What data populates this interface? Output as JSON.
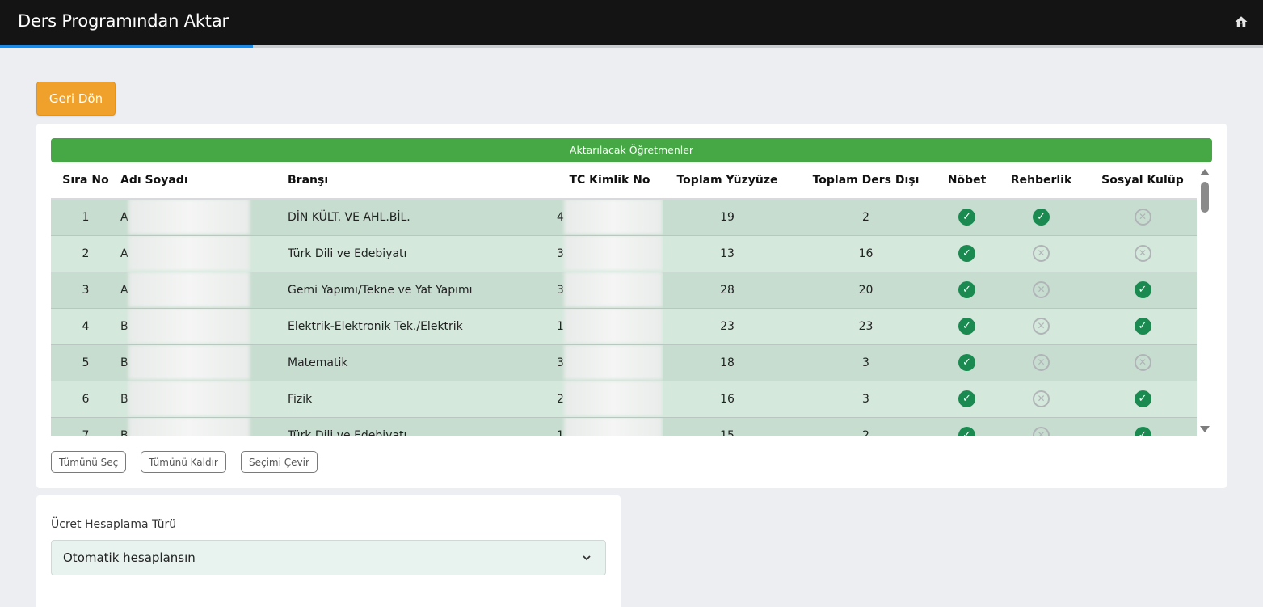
{
  "header": {
    "title": "Ders Programından Aktar",
    "home_icon": "home-icon",
    "progress": 0.2
  },
  "back_button": "Geri Dön",
  "teachers_panel": {
    "banner": "Aktarılacak Öğretmenler",
    "columns": [
      "Sıra No",
      "Adı Soyadı",
      "Branşı",
      "TC Kimlik No",
      "Toplam Yüzyüze",
      "Toplam Ders Dışı",
      "Nöbet",
      "Rehberlik",
      "Sosyal Kulüp"
    ],
    "rows": [
      {
        "no": "1",
        "name": "A",
        "branch": "DİN KÜLT. VE AHL.BİL.",
        "tc": "4",
        "yuzyuze": "19",
        "ders_disi": "2",
        "nobet": true,
        "rehberlik": true,
        "sosyal": false
      },
      {
        "no": "2",
        "name": "A",
        "branch": "Türk Dili ve Edebiyatı",
        "tc": "3",
        "yuzyuze": "13",
        "ders_disi": "16",
        "nobet": true,
        "rehberlik": false,
        "sosyal": false
      },
      {
        "no": "3",
        "name": "A",
        "branch": "Gemi Yapımı/Tekne ve Yat Yapımı",
        "tc": "3",
        "yuzyuze": "28",
        "ders_disi": "20",
        "nobet": true,
        "rehberlik": false,
        "sosyal": true
      },
      {
        "no": "4",
        "name": "B",
        "branch": "Elektrik-Elektronik Tek./Elektrik",
        "tc": "1",
        "yuzyuze": "23",
        "ders_disi": "23",
        "nobet": true,
        "rehberlik": false,
        "sosyal": true
      },
      {
        "no": "5",
        "name": "B",
        "branch": "Matematik",
        "tc": "3",
        "yuzyuze": "18",
        "ders_disi": "3",
        "nobet": true,
        "rehberlik": false,
        "sosyal": false
      },
      {
        "no": "6",
        "name": "B",
        "branch": "Fizik",
        "tc": "2",
        "yuzyuze": "16",
        "ders_disi": "3",
        "nobet": true,
        "rehberlik": false,
        "sosyal": true
      },
      {
        "no": "7",
        "name": "B",
        "branch": "Türk Dili ve Edebiyatı",
        "tc": "1",
        "yuzyuze": "15",
        "ders_disi": "2",
        "nobet": true,
        "rehberlik": false,
        "sosyal": true
      }
    ],
    "buttons": {
      "select_all": "Tümünü Seç",
      "remove_all": "Tümünü Kaldır",
      "invert": "Seçimi Çevir"
    }
  },
  "fee_panel": {
    "label": "Ücret Hesaplama Türü",
    "selected": "Otomatik hesaplansın"
  },
  "colors": {
    "banner": "#46a845",
    "back_button": "#f0a12c",
    "check": "#1a8a50",
    "progress": "#1e88e5"
  }
}
